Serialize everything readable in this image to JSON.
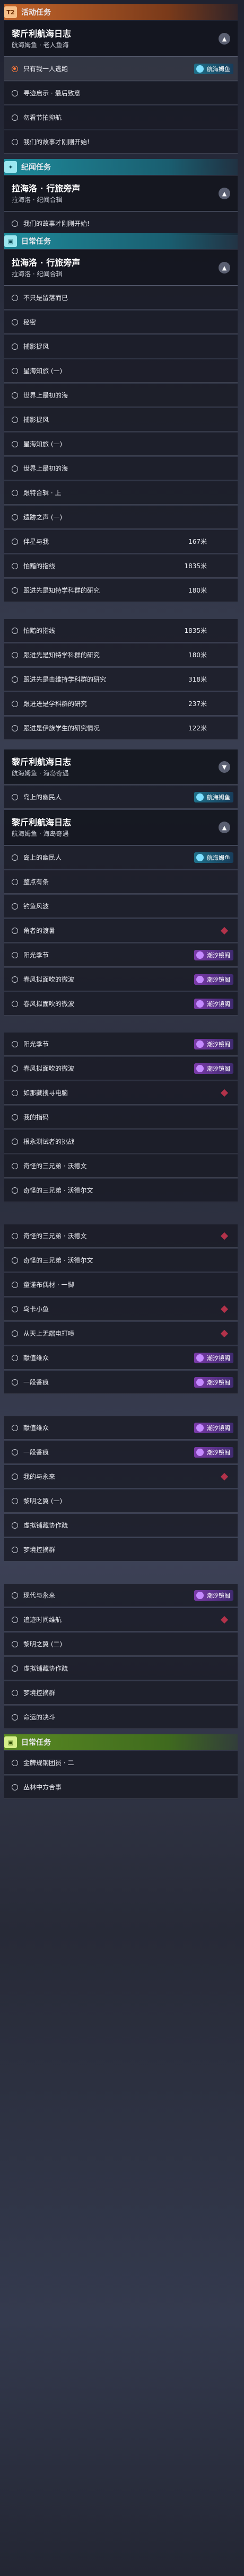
{
  "categories": {
    "event": {
      "tag": "T2",
      "label": "活动任务"
    },
    "discovery": {
      "tag": "✦",
      "label": "纪闻任务"
    },
    "daily": {
      "tag": "▣",
      "label": "日常任务"
    }
  },
  "headers": [
    {
      "title": "黎斤利航海日志",
      "sub": "航海姆鱼 · 老人鱼海",
      "chev": "▲"
    },
    {
      "title": "拉海洛 · 行旅旁声",
      "sub": "拉海洛 · 纪闻合辑",
      "chev": "▲"
    },
    {
      "title": "拉海洛 · 行旅旁声",
      "sub": "拉海洛 · 纪闻合辑",
      "chev": "▲"
    },
    {
      "title": "黎斤利航海日志",
      "sub": "航海姆鱼 · 海岛奇遇",
      "chev": "▼"
    },
    {
      "title": "黎斤利航海日志",
      "sub": "航海姆鱼 · 海岛奇遇",
      "chev": "▲"
    }
  ],
  "nav": {
    "purple": "潮汐镜阁",
    "cyan": "航海姆鱼"
  },
  "items": [
    "只有我一人逃跑",
    "寻迹启示 · 最后致意",
    "勿看节拍抑航",
    "我们的故事才刚刚开始!",
    "我们的故事才刚刚开始!",
    "不只是留落而已",
    "秘密",
    "捕影捉风",
    "星海知旅 (一)",
    "世界上最初的海",
    "捕影捉风",
    "星海知旅 (一)",
    "世界上最初的海",
    "跟特合辑 · 上",
    "遗跡之声 (一)",
    "伴星与我",
    "怕黯的指线",
    "跟进先是知特学科群的研究",
    "怕黯的指线",
    "跟进先是知特学科群的研究",
    "跟进先是击维持学科群的研究",
    "跟进进是学科群的研究",
    "跟进是伊族学生的研究情况",
    "岛上的幽民人",
    "岛上的幽民人",
    "整点有条",
    "钓鱼风波",
    "角者的渡暑",
    "阳光季节",
    "春风拟面吹的微波",
    "春风拟面吹的微波",
    "阳光季节",
    "春风拟面吹的微波",
    "如那藏搜寻电脑",
    "我的指码",
    "根永测试者的挑战",
    "奇怪的三兄弟 · 沃德文",
    "奇怪的三兄弟 · 沃德尔文",
    "奇怪的三兄弟 · 沃德文",
    "奇怪的三兄弟 · 沃德尔文",
    "童谨布偶材 · 一脚",
    "鸟卡小鱼",
    "从天上无端电打喷",
    "献值维众",
    "一段香痕",
    "献值维众",
    "一段香痕",
    "我的与永来",
    "黎明之翼 (一)",
    "虚拟铺藏协作疏",
    "梦境控摘群",
    "现代与永来",
    "追迹时间维航",
    "黎明之翼 (二)",
    "虚拟铺藏协作疏",
    "梦境控摘群",
    "命运的决斗",
    "金牌规钢团员 · 二",
    "丛林中方合事"
  ],
  "distances": [
    "167米",
    "1835米",
    "180米",
    "1835米",
    "180米",
    "318米",
    "237米",
    "122米"
  ]
}
